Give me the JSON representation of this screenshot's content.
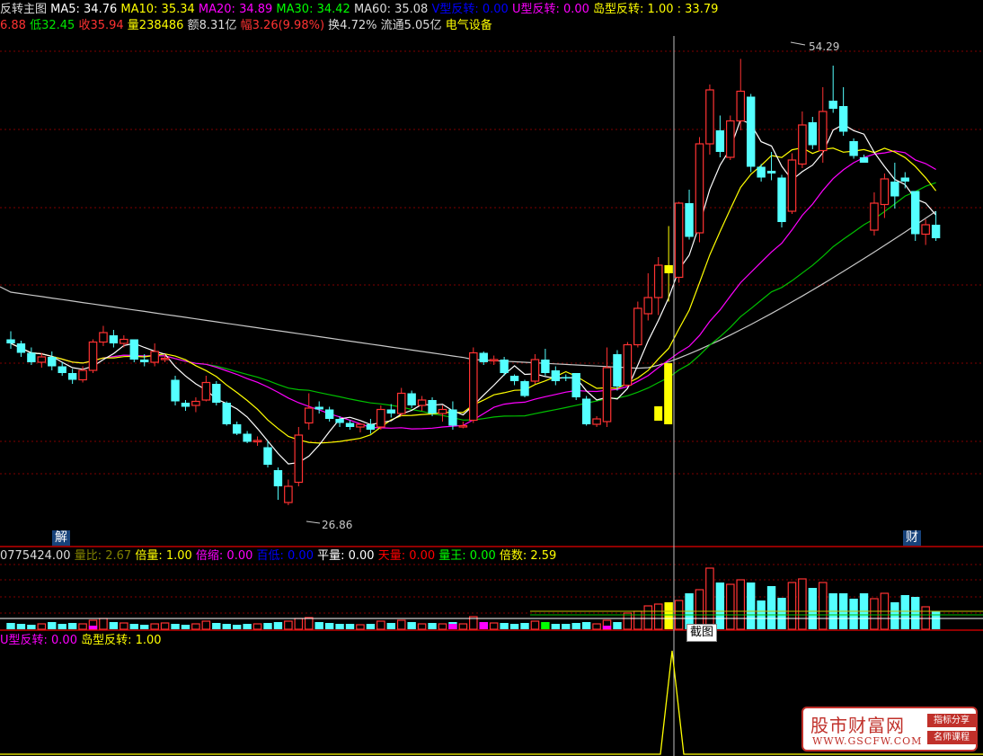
{
  "header": {
    "title": {
      "text": "反转主图",
      "color": "#dcdcdc"
    },
    "items": [
      {
        "text": "MA5: 34.76",
        "color": "#ffffff"
      },
      {
        "text": "MA10: 35.34",
        "color": "#ffff00"
      },
      {
        "text": "MA20: 34.89",
        "color": "#ff00ff"
      },
      {
        "text": "MA30: 34.42",
        "color": "#00ff00"
      },
      {
        "text": "MA60: 35.08",
        "color": "#dcdcdc"
      },
      {
        "text": "V型反转: 0.00",
        "color": "#0000ff"
      },
      {
        "text": "U型反转: 0.00",
        "color": "#ff00ff"
      },
      {
        "text": "岛型反转: 1.00",
        "color": "#ffff00"
      },
      {
        "text": ": 33.79",
        "color": "#ffff00"
      }
    ]
  },
  "quote": [
    {
      "text": "6.88",
      "color": "#ff3232"
    },
    {
      "text": "低32.45",
      "color": "#00e600"
    },
    {
      "text": "收35.94",
      "color": "#ff3232"
    },
    {
      "text": "量238486",
      "color": "#ffff00"
    },
    {
      "text": "额8.31亿",
      "color": "#dcdcdc"
    },
    {
      "text": "幅3.26(9.98%)",
      "color": "#ff3232"
    },
    {
      "text": "换4.72%",
      "color": "#dcdcdc"
    },
    {
      "text": "流通5.05亿",
      "color": "#dcdcdc"
    },
    {
      "text": "电气设备",
      "color": "#ffff00"
    }
  ],
  "price_labels": {
    "high": "54.29",
    "low": "26.86"
  },
  "markers": {
    "jie": "解",
    "cai": "财"
  },
  "volume_header": [
    {
      "text": "0775424.00",
      "color": "#dcdcdc"
    },
    {
      "text": "量比: ",
      "color": "#808000"
    },
    {
      "text": "2.67",
      "color": "#808000"
    },
    {
      "text": "倍量: 1.00",
      "color": "#ffff00"
    },
    {
      "text": "倍缩: 0.00",
      "color": "#ff00ff"
    },
    {
      "text": "百低: ",
      "color": "#0000ff"
    },
    {
      "text": "0.00",
      "color": "#0000ff"
    },
    {
      "text": "平量: 0.00",
      "color": "#ffffff"
    },
    {
      "text": "天量: 0.00",
      "color": "#ff0000"
    },
    {
      "text": "量王: 0.00",
      "color": "#00ff00"
    },
    {
      "text": "倍数: 2.59",
      "color": "#ffff00"
    }
  ],
  "indicator_header": [
    {
      "text": "U型反转: 0.00",
      "color": "#ff00ff"
    },
    {
      "text": "岛型反转: 1.00",
      "color": "#ffff00"
    }
  ],
  "tooltip": "截图",
  "watermark": {
    "title": "股市财富网",
    "url": "WWW.GSCFW.COM",
    "badge1": "指标分享",
    "badge2": "名师课程"
  },
  "colors": {
    "up": "#ff3232",
    "down": "#54ffff",
    "grid": "#800000",
    "cursor": "#c0c0c0",
    "highlight": "#ffff00"
  },
  "candles": [
    [
      33.5,
      34.1,
      32.8,
      33.2
    ],
    [
      33.2,
      33.4,
      32.2,
      32.5
    ],
    [
      32.5,
      32.9,
      31.6,
      31.8
    ],
    [
      31.8,
      32.5,
      31.4,
      32.2
    ],
    [
      32.2,
      32.6,
      31.2,
      31.5
    ],
    [
      31.5,
      31.8,
      30.8,
      31.0
    ],
    [
      31.0,
      31.3,
      30.2,
      30.5
    ],
    [
      30.5,
      31.5,
      30.3,
      31.2
    ],
    [
      31.2,
      33.5,
      31.0,
      33.3
    ],
    [
      33.3,
      34.5,
      33.0,
      34.0
    ],
    [
      33.8,
      34.2,
      32.9,
      33.2
    ],
    [
      33.2,
      33.8,
      32.9,
      33.5
    ],
    [
      33.5,
      33.5,
      31.8,
      32.0
    ],
    [
      32.0,
      32.4,
      31.5,
      31.8
    ],
    [
      31.8,
      33.2,
      31.5,
      32.6
    ],
    [
      32.0,
      32.4,
      31.8,
      32.1
    ],
    [
      30.5,
      30.8,
      28.6,
      28.9
    ],
    [
      28.8,
      29.0,
      28.2,
      28.5
    ],
    [
      28.6,
      29.2,
      28.1,
      28.9
    ],
    [
      29.0,
      30.8,
      28.9,
      30.3
    ],
    [
      30.2,
      30.4,
      28.6,
      28.8
    ],
    [
      28.8,
      28.9,
      27.1,
      27.2
    ],
    [
      27.2,
      27.4,
      26.4,
      26.5
    ],
    [
      26.5,
      26.7,
      25.8,
      25.9
    ],
    [
      25.9,
      26.3,
      25.6,
      26.0
    ],
    [
      25.5,
      26.0,
      24.0,
      24.2
    ],
    [
      23.8,
      24.0,
      21.6,
      22.6
    ],
    [
      21.4,
      23.1,
      21.2,
      22.6
    ],
    [
      22.9,
      27.0,
      22.6,
      26.4
    ],
    [
      27.3,
      29.5,
      26.8,
      28.4
    ],
    [
      28.5,
      28.9,
      28.0,
      28.3
    ],
    [
      28.3,
      28.5,
      27.4,
      27.6
    ],
    [
      27.6,
      27.8,
      27.0,
      27.3
    ],
    [
      27.3,
      27.5,
      26.8,
      27.0
    ],
    [
      27.0,
      27.3,
      26.6,
      27.2
    ],
    [
      27.2,
      27.6,
      26.5,
      26.8
    ],
    [
      27.0,
      28.6,
      26.8,
      28.3
    ],
    [
      28.3,
      28.7,
      27.7,
      28.0
    ],
    [
      28.0,
      29.9,
      27.8,
      29.5
    ],
    [
      29.5,
      29.7,
      28.4,
      28.6
    ],
    [
      28.6,
      29.3,
      28.2,
      29.0
    ],
    [
      29.0,
      29.2,
      27.8,
      28.0
    ],
    [
      28.0,
      28.6,
      27.4,
      28.3
    ],
    [
      28.3,
      28.9,
      26.8,
      27.1
    ],
    [
      27.0,
      27.4,
      26.9,
      27.1
    ],
    [
      27.5,
      32.9,
      27.3,
      32.5
    ],
    [
      32.5,
      32.6,
      31.6,
      31.8
    ],
    [
      31.9,
      32.3,
      31.6,
      32.0
    ],
    [
      32.0,
      32.2,
      30.8,
      31.0
    ],
    [
      30.8,
      30.9,
      30.1,
      30.4
    ],
    [
      30.4,
      30.5,
      29.2,
      29.3
    ],
    [
      30.4,
      32.4,
      30.2,
      32.0
    ],
    [
      32.0,
      32.8,
      30.8,
      31.0
    ],
    [
      31.2,
      31.5,
      30.1,
      30.4
    ],
    [
      30.7,
      30.9,
      30.4,
      30.6
    ],
    [
      31.0,
      31.0,
      29.0,
      29.2
    ],
    [
      29.1,
      29.3,
      27.1,
      27.2
    ],
    [
      27.2,
      27.8,
      27.0,
      27.6
    ],
    [
      27.4,
      32.9,
      27.0,
      31.4
    ],
    [
      32.4,
      32.7,
      29.7,
      30.0
    ],
    [
      30.1,
      33.3,
      30.0,
      33.1
    ],
    [
      33.1,
      36.3,
      32.9,
      35.8
    ],
    [
      35.4,
      38.4,
      34.9,
      36.6
    ],
    [
      36.6,
      39.6,
      35.3,
      39.0
    ],
    [
      39.0,
      41.9,
      36.3,
      38.4
    ],
    [
      38.1,
      43.7,
      37.7,
      43.6
    ],
    [
      43.6,
      44.6,
      40.9,
      41.1
    ],
    [
      41.4,
      48.5,
      40.7,
      48.0
    ],
    [
      48.0,
      52.4,
      47.2,
      52.0
    ],
    [
      49.0,
      50.1,
      47.0,
      47.4
    ],
    [
      47.0,
      50.1,
      46.8,
      49.7
    ],
    [
      49.7,
      54.3,
      49.0,
      51.9
    ],
    [
      51.5,
      51.7,
      45.9,
      46.3
    ],
    [
      46.3,
      46.5,
      45.2,
      45.5
    ],
    [
      46.0,
      47.4,
      45.3,
      45.8
    ],
    [
      45.5,
      45.7,
      41.8,
      42.2
    ],
    [
      43.0,
      47.3,
      42.8,
      46.8
    ],
    [
      46.5,
      50.4,
      46.2,
      49.4
    ],
    [
      49.6,
      50.0,
      47.6,
      47.9
    ],
    [
      47.5,
      52.2,
      46.6,
      50.4
    ],
    [
      51.2,
      53.8,
      50.3,
      50.6
    ],
    [
      50.8,
      52.2,
      48.6,
      48.9
    ],
    [
      48.2,
      48.4,
      46.9,
      47.1
    ],
    [
      47.0,
      47.2,
      46.6,
      46.6
    ],
    [
      41.6,
      44.4,
      41.2,
      43.6
    ],
    [
      43.5,
      45.8,
      42.5,
      45.4
    ],
    [
      45.2,
      46.6,
      43.2,
      44.1
    ],
    [
      45.5,
      45.9,
      44.7,
      45.2
    ],
    [
      44.5,
      44.5,
      40.8,
      41.3
    ],
    [
      41.3,
      42.4,
      40.5,
      42.0
    ],
    [
      42.0,
      43.0,
      40.8,
      41.0
    ]
  ],
  "volumes": [
    [
      7,
      0
    ],
    [
      6,
      0
    ],
    [
      5,
      0
    ],
    [
      6,
      0
    ],
    [
      8,
      0
    ],
    [
      6,
      0
    ],
    [
      7,
      0
    ],
    [
      6,
      0
    ],
    [
      10,
      2
    ],
    [
      12,
      0
    ],
    [
      8,
      0
    ],
    [
      7,
      0
    ],
    [
      6,
      0
    ],
    [
      5,
      0
    ],
    [
      6,
      0
    ],
    [
      7,
      0
    ],
    [
      6,
      0
    ],
    [
      5,
      0
    ],
    [
      6,
      0
    ],
    [
      9,
      0
    ],
    [
      7,
      0
    ],
    [
      6,
      0
    ],
    [
      5,
      0
    ],
    [
      6,
      0
    ],
    [
      6,
      0
    ],
    [
      7,
      0
    ],
    [
      8,
      0
    ],
    [
      9,
      0
    ],
    [
      12,
      0
    ],
    [
      13,
      0
    ],
    [
      8,
      0
    ],
    [
      7,
      0
    ],
    [
      6,
      0
    ],
    [
      6,
      0
    ],
    [
      5,
      0
    ],
    [
      6,
      0
    ],
    [
      9,
      0
    ],
    [
      7,
      0
    ],
    [
      10,
      0
    ],
    [
      8,
      0
    ],
    [
      6,
      0
    ],
    [
      7,
      0
    ],
    [
      6,
      0
    ],
    [
      8,
      3
    ],
    [
      6,
      0
    ],
    [
      14,
      0
    ],
    [
      8,
      4
    ],
    [
      7,
      0
    ],
    [
      7,
      0
    ],
    [
      6,
      0
    ],
    [
      7,
      0
    ],
    [
      9,
      0
    ],
    [
      8,
      0
    ],
    [
      6,
      0
    ],
    [
      6,
      0
    ],
    [
      7,
      0
    ],
    [
      8,
      0
    ],
    [
      6,
      0
    ],
    [
      10,
      2
    ],
    [
      8,
      0
    ],
    [
      18,
      0
    ],
    [
      20,
      0
    ],
    [
      26,
      0
    ],
    [
      28,
      0
    ],
    [
      30,
      0
    ],
    [
      32,
      0
    ],
    [
      40,
      0
    ],
    [
      44,
      0
    ],
    [
      68,
      0
    ],
    [
      52,
      0
    ],
    [
      50,
      0
    ],
    [
      55,
      0
    ],
    [
      52,
      0
    ],
    [
      32,
      0
    ],
    [
      48,
      0
    ],
    [
      35,
      0
    ],
    [
      52,
      0
    ],
    [
      56,
      0
    ],
    [
      46,
      0
    ],
    [
      52,
      0
    ],
    [
      40,
      0
    ],
    [
      40,
      0
    ],
    [
      34,
      0
    ],
    [
      40,
      0
    ],
    [
      34,
      0
    ],
    [
      40,
      0
    ],
    [
      30,
      0
    ],
    [
      38,
      0
    ],
    [
      36,
      0
    ],
    [
      25,
      0
    ],
    [
      20,
      0
    ]
  ]
}
